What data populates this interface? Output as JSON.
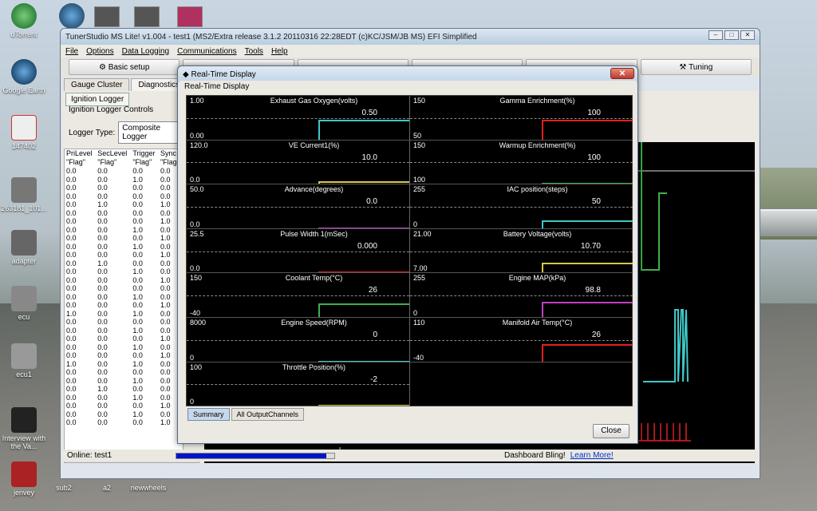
{
  "desktop": {
    "icons": [
      {
        "label": "uTorrent"
      },
      {
        "label": "Google Earth"
      },
      {
        "label": "147402"
      },
      {
        "label": "263181_101..."
      },
      {
        "label": "adapter"
      },
      {
        "label": "ecu"
      },
      {
        "label": "ecu1"
      },
      {
        "label": "Interview with the Va..."
      },
      {
        "label": "jenvey"
      },
      {
        "label": "sub2"
      },
      {
        "label": "a2"
      },
      {
        "label": "newwheels"
      }
    ]
  },
  "main": {
    "title": "TunerStudio MS Lite! v1.004 - test1 (MS2/Extra release 3.1.2 20110316 22:28EDT (c)KC/JSM/JB MS) EFI Simplified",
    "menu": [
      "File",
      "Options",
      "Data Logging",
      "Communications",
      "Tools",
      "Help"
    ],
    "toolbar": {
      "basic_setup": "Basic setup",
      "tuning": "Tuning"
    },
    "tabs": [
      "Gauge Cluster",
      "Diagnostics"
    ],
    "subtab": "Ignition Logger",
    "controls_label": "Ignition Logger Controls",
    "logger_type_label": "Logger Type:",
    "logger_type_value": "Composite Logger",
    "log_headers": [
      "PriLevel",
      "SecLevel",
      "Trigger",
      "Sync"
    ],
    "log_units": [
      "\"Flag\"",
      "\"Flag\"",
      "\"Flag\"",
      "\"Flag\""
    ],
    "log_rows": [
      [
        "0.0",
        "0.0",
        "0.0",
        "0.0"
      ],
      [
        "0.0",
        "0.0",
        "1.0",
        "0.0"
      ],
      [
        "0.0",
        "0.0",
        "0.0",
        "0.0"
      ],
      [
        "0.0",
        "0.0",
        "0.0",
        "0.0"
      ],
      [
        "0.0",
        "1.0",
        "0.0",
        "1.0"
      ],
      [
        "0.0",
        "0.0",
        "0.0",
        "0.0"
      ],
      [
        "0.0",
        "0.0",
        "0.0",
        "1.0"
      ],
      [
        "0.0",
        "0.0",
        "1.0",
        "0.0"
      ],
      [
        "0.0",
        "0.0",
        "0.0",
        "1.0"
      ],
      [
        "0.0",
        "0.0",
        "1.0",
        "0.0"
      ],
      [
        "0.0",
        "0.0",
        "0.0",
        "1.0"
      ],
      [
        "0.0",
        "1.0",
        "0.0",
        "0.0"
      ],
      [
        "0.0",
        "0.0",
        "1.0",
        "0.0"
      ],
      [
        "0.0",
        "0.0",
        "0.0",
        "1.0"
      ],
      [
        "0.0",
        "0.0",
        "0.0",
        "0.0"
      ],
      [
        "0.0",
        "0.0",
        "1.0",
        "0.0"
      ],
      [
        "0.0",
        "0.0",
        "0.0",
        "1.0"
      ],
      [
        "1.0",
        "0.0",
        "1.0",
        "0.0"
      ],
      [
        "0.0",
        "0.0",
        "0.0",
        "0.0"
      ],
      [
        "0.0",
        "0.0",
        "1.0",
        "0.0"
      ],
      [
        "0.0",
        "0.0",
        "0.0",
        "1.0"
      ],
      [
        "0.0",
        "0.0",
        "1.0",
        "0.0"
      ],
      [
        "0.0",
        "0.0",
        "0.0",
        "1.0"
      ],
      [
        "1.0",
        "0.0",
        "1.0",
        "0.0"
      ],
      [
        "0.0",
        "0.0",
        "0.0",
        "0.0"
      ],
      [
        "0.0",
        "0.0",
        "1.0",
        "0.0"
      ],
      [
        "0.0",
        "1.0",
        "0.0",
        "0.0"
      ],
      [
        "0.0",
        "0.0",
        "1.0",
        "0.0"
      ],
      [
        "0.0",
        "0.0",
        "0.0",
        "1.0"
      ],
      [
        "0.0",
        "0.0",
        "1.0",
        "0.0"
      ],
      [
        "0.0",
        "0.0",
        "0.0",
        "1.0"
      ]
    ],
    "status": {
      "online": "Online: test1",
      "progress": 0.95,
      "dashboard_text": "Dashboard Bling!",
      "learn_more": "Learn More!"
    }
  },
  "dialog": {
    "title": "Real-Time Display",
    "header": "Real-Time Display",
    "gauges": [
      {
        "title": "Exhaust Gas Oxygen(volts)",
        "max": "1.00",
        "min": "0.00",
        "value": "0.50",
        "color": "#3fc7c7",
        "level": 0.5
      },
      {
        "title": "Gamma Enrichment(%)",
        "max": "150",
        "min": "50",
        "value": "100",
        "color": "#e02020",
        "level": 0.5
      },
      {
        "title": "VE Current1(%)",
        "max": "120.0",
        "min": "0.0",
        "value": "10.0",
        "color": "#d4c84a",
        "level": 0.08
      },
      {
        "title": "Warmup Enrichment(%)",
        "max": "150",
        "min": "100",
        "value": "100",
        "color": "#3fb04a",
        "level": 0.0
      },
      {
        "title": "Advance(degrees)",
        "max": "50.0",
        "min": "0.0",
        "value": "0.0",
        "color": "#c040c0",
        "level": 0.0
      },
      {
        "title": "IAC position(steps)",
        "max": "255",
        "min": "0",
        "value": "50",
        "color": "#3fc7c7",
        "level": 0.2
      },
      {
        "title": "Pulse Width 1(mSec)",
        "max": "25.5",
        "min": "0.0",
        "value": "0.000",
        "color": "#e02020",
        "level": 0.0
      },
      {
        "title": "Battery Voltage(volts)",
        "max": "21.00",
        "min": "7.00",
        "value": "10.70",
        "color": "#d4c84a",
        "level": 0.26
      },
      {
        "title": "Coolant Temp(°C)",
        "max": "150",
        "min": "-40",
        "value": "26",
        "color": "#3fb04a",
        "level": 0.35
      },
      {
        "title": "Engine MAP(kPa)",
        "max": "255",
        "min": "0",
        "value": "98.8",
        "color": "#c040c0",
        "level": 0.39
      },
      {
        "title": "Engine Speed(RPM)",
        "max": "8000",
        "min": "0",
        "value": "0",
        "color": "#3fc7c7",
        "level": 0.0
      },
      {
        "title": "Manifold Air Temp(°C)",
        "max": "110",
        "min": "-40",
        "value": "26",
        "color": "#e02020",
        "level": 0.44
      },
      {
        "title": "Throttle Position(%)",
        "max": "100",
        "min": "0",
        "value": "-2",
        "color": "#d4c84a",
        "level": 0.0
      }
    ],
    "tabs": [
      "Summary",
      "All OutputChannels"
    ],
    "close_label": "Close"
  }
}
